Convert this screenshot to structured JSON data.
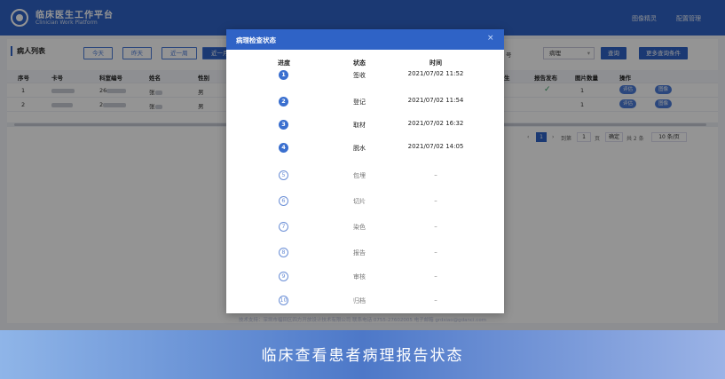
{
  "header": {
    "title": "临床医生工作平台",
    "subtitle": "Clinician Work Platform",
    "links": [
      "图像精灵",
      "配置管理"
    ]
  },
  "list": {
    "title": "病人列表",
    "quick_buttons": [
      "今天",
      "昨天",
      "近一周",
      "近一月"
    ],
    "search_field_tail": "号",
    "select_value": "病理",
    "search_label": "查询",
    "more_label": "更多查询条件"
  },
  "table": {
    "columns": [
      "序号",
      "卡号",
      "科室编号",
      "姓名",
      "性别",
      "生",
      "报告发布",
      "图片数量",
      "操作"
    ],
    "rows": [
      {
        "index": "1",
        "card": "",
        "dept": "26",
        "name": "张",
        "gender": "男",
        "published": "✓",
        "images": "1"
      },
      {
        "index": "2",
        "card": "",
        "dept": "2",
        "name": "张",
        "gender": "男",
        "published": "",
        "images": "1"
      }
    ],
    "action_labels": [
      "评估",
      "图像"
    ]
  },
  "pagination": {
    "current": "1",
    "goto_label": "到第",
    "goto_value": "1",
    "page_unit": "页",
    "confirm": "确定",
    "total": "共 2 条",
    "page_size": "10 条/页"
  },
  "footer_text": "技术支持：深圳市福田区四方开放设计技术有限公司 联系电话 0755-27602005 电子邮箱 grdsiao@gdanci.com",
  "modal": {
    "title": "病理检查状态",
    "close": "×",
    "headers": {
      "progress": "进度",
      "status": "状态",
      "time": "时间"
    },
    "steps": [
      {
        "num": "1",
        "status": "签收",
        "time": "2021/07/02 11:52",
        "done": true
      },
      {
        "num": "2",
        "status": "登记",
        "time": "2021/07/02 11:54",
        "done": true
      },
      {
        "num": "3",
        "status": "取材",
        "time": "2021/07/02 16:32",
        "done": true
      },
      {
        "num": "4",
        "status": "脱水",
        "time": "2021/07/02 14:05",
        "done": true
      },
      {
        "num": "5",
        "status": "包埋",
        "time": "–",
        "done": false
      },
      {
        "num": "6",
        "status": "切片",
        "time": "–",
        "done": false
      },
      {
        "num": "7",
        "status": "染色",
        "time": "–",
        "done": false
      },
      {
        "num": "8",
        "status": "报告",
        "time": "–",
        "done": false
      },
      {
        "num": "9",
        "status": "审核",
        "time": "–",
        "done": false
      },
      {
        "num": "10",
        "status": "归档",
        "time": "–",
        "done": false
      }
    ]
  },
  "banner": {
    "text": "临床查看患者病理报告状态"
  },
  "colors": {
    "primary": "#2f63c6",
    "step_done": "#3a6fcf",
    "step_todo": "#6b8fd6"
  }
}
